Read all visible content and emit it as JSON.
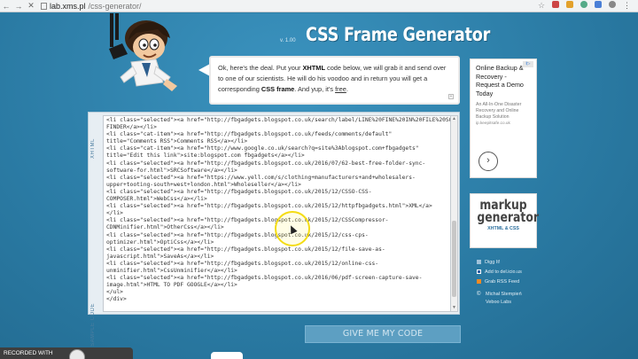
{
  "browser": {
    "url_host": "lab.xms.pl",
    "url_path": "/css-generator/",
    "back_icon": "back-arrow-icon",
    "forward_icon": "forward-arrow-icon",
    "close_icon": "close-icon"
  },
  "header": {
    "version": "v. 1.00",
    "title": "CSS Frame Generator"
  },
  "bubble": {
    "part1": "Ok, here's the deal. Put your ",
    "xhtml": "XHTML",
    "part2": " code below, we will grab it and send over to one of our scientists. He will do his voodoo and in return you will get a corresponding ",
    "cssframe": "CSS frame",
    "part3": ". And yup, it's ",
    "free": "free",
    "part4": "."
  },
  "code_panel": {
    "side_top_label": "XHTML",
    "side_bottom_label": "INSERT SAMPLE CODE",
    "lines": [
      "<li class=\"selected\"><a href=\"http://fbgadgets.blogspot.co.uk/search/label/LINE%20FINE%20IN%20FILE%20SOFTWARE\">LINE",
      "FINDER</a></li>",
      "<li class=\"cat-item\"><a href=\"http://fbgadgets.blogspot.co.uk/feeds/comments/default\"",
      "title=\"Comments RSS\">Comments RSS</a></li>",
      "<li class=\"cat-item\"><a href=\"http://www.google.co.uk/search?q=site%3Ablogspot.com+fbgadgets\"",
      "title=\"Edit this link\">site:blogspot.com fbgadgets</a></li>",
      "<li class=\"selected\"><a href=\"http://fbgadgets.blogspot.co.uk/2016/07/62-best-free-folder-sync-",
      "software-for.html\">SRCSoftware</a></li>",
      "<li class=\"selected\"><a href=\"https://www.yell.com/s/clothing+manufacturers+and+wholesalers-",
      "upper+tooting-south+west+london.html\">Wholeseller</a></li>",
      "<li class=\"selected\"><a href=\"http://fbgadgets.blogspot.co.uk/2015/12/CSSO-CSS-",
      "COMPOSER.html\">WebCss</a></li>",
      "<li class=\"selected\"><a href=\"http://fbgadgets.blogspot.co.uk/2015/12/httpfbgadgets.html\">XML</a>",
      "</li>",
      "<li class=\"selected\"><a href=\"http://fbgadgets.blogspot.co.uk/2015/12/CSSCompressor-",
      "CDNMinifier.html\">OtherCss</a></li>",
      "<li class=\"selected\"><a href=\"http://fbgadgets.blogspot.co.uk/2015/12/css-cps-",
      "optimizer.html\">OptiCss</a></li>",
      "<li class=\"selected\"><a href=\"http://fbgadgets.blogspot.co.uk/2015/12/file-save-as-",
      "javascript.html\">SaveAs</a></li>",
      "<li class=\"selected\"><a href=\"http://fbgadgets.blogspot.co.uk/2015/12/online-css-",
      "unminifier.html\">CssUnminifier</a></li>",
      "<li class=\"selected\"><a href=\"http://fbgadgets.blogspot.co.uk/2016/06/pdf-screen-capture-save-",
      "image.html\">HTML TO PDF GOOGLE</a></li>",
      "</ul>",
      "</div>"
    ]
  },
  "give_button": "GIVE ME MY CODE",
  "ad": {
    "heading": "Online Backup & Recovery - Request a Demo Today",
    "body": "An All-In-One Disaster Recovery and Online Backup Solution",
    "site": "ip.keepitsafe.co.uk",
    "go_icon": "chevron-right-icon"
  },
  "markup_ad": {
    "line1": "markup",
    "line2": "generator",
    "line3": "XHTML & CSS"
  },
  "links": {
    "digg": "Digg It!",
    "delicious": "Add to del.icio.us",
    "rss": "Grab RSS Feed"
  },
  "credit": {
    "line1": "Michał Stempień",
    "line2": "Veboo Labs"
  },
  "recorder": {
    "label": "RECORDED WITH"
  }
}
